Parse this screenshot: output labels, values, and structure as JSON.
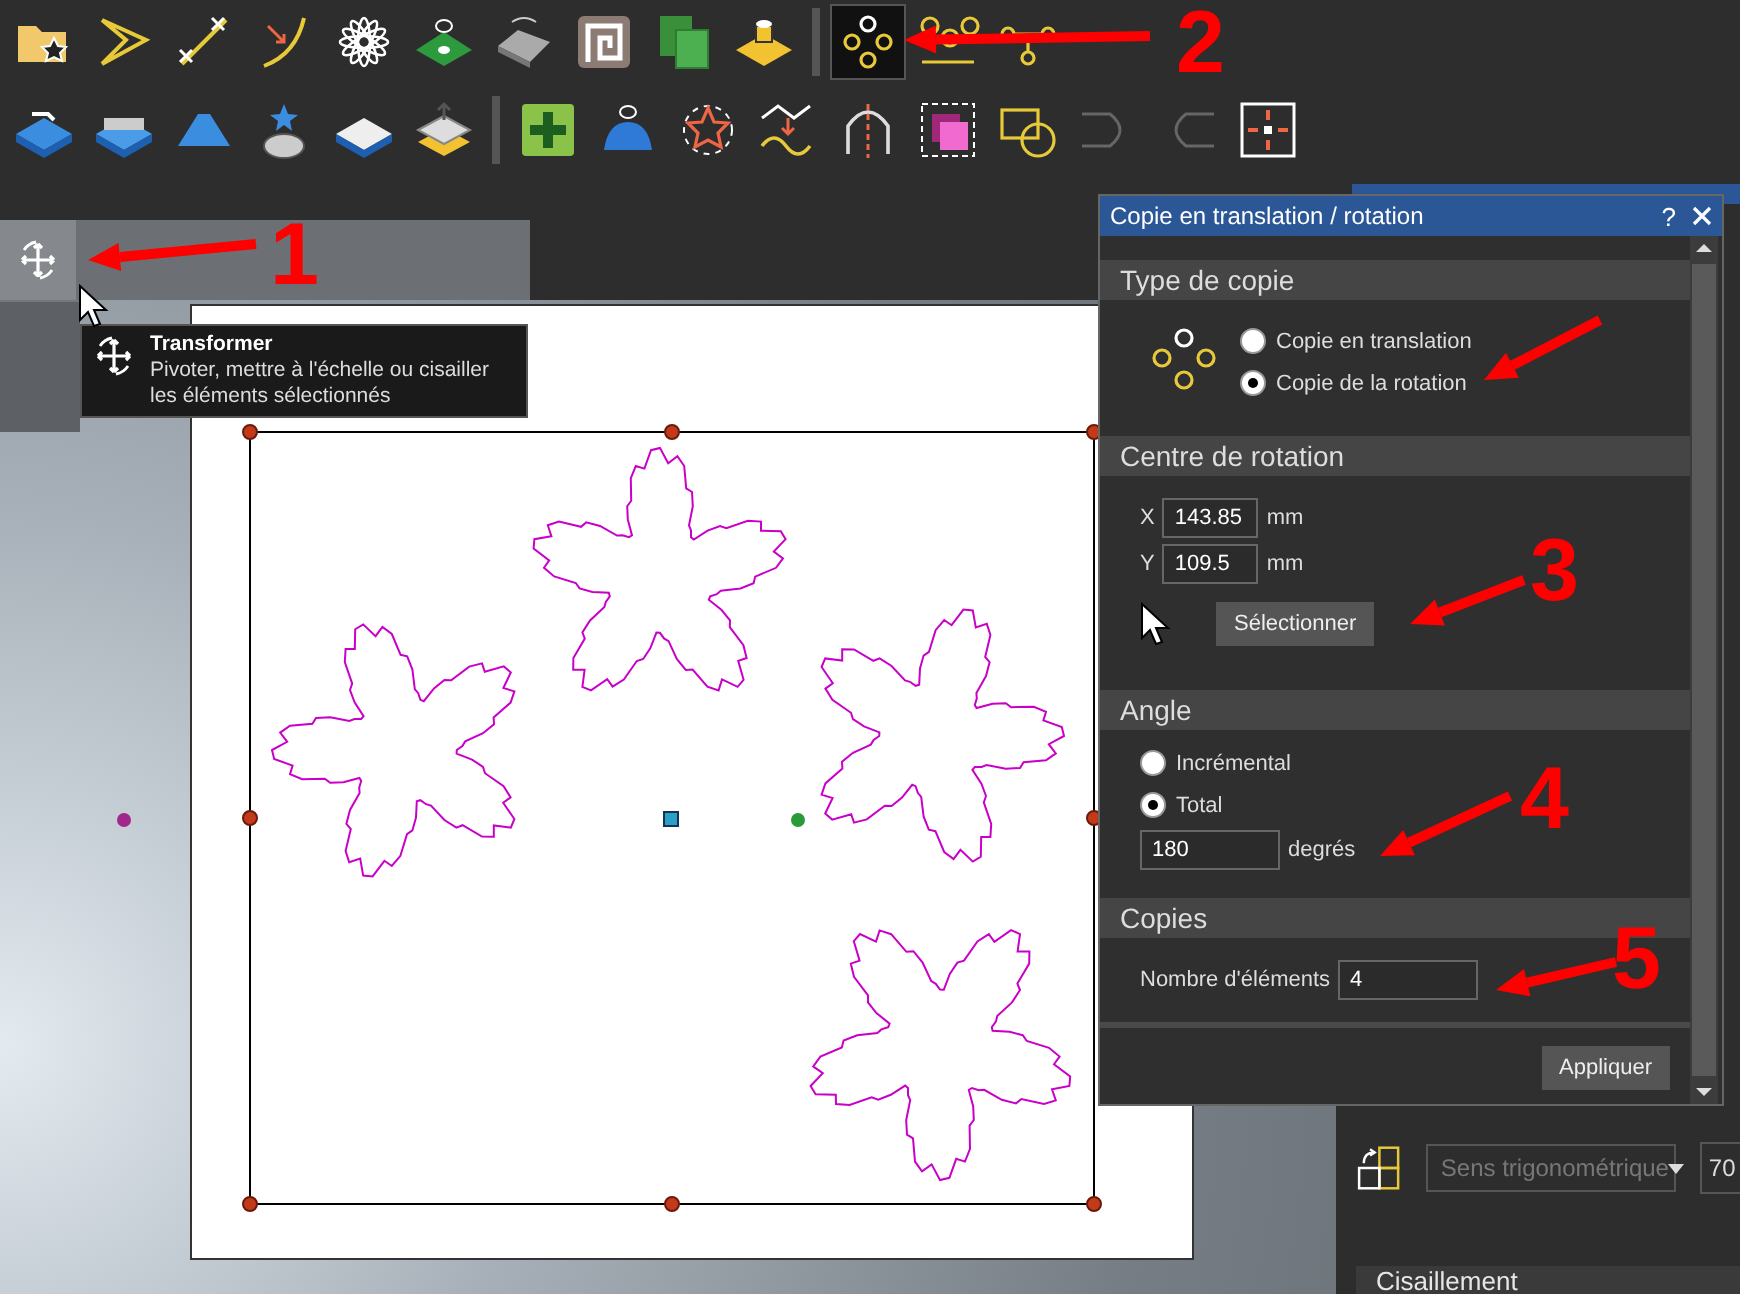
{
  "toolbar": {
    "rows": [
      {
        "items": [
          {
            "selected": false
          },
          {
            "selected": false
          },
          {
            "selected": false
          },
          {
            "selected": false
          },
          {
            "selected": false
          },
          {
            "selected": false
          },
          {
            "selected": false
          },
          {
            "selected": false
          },
          {
            "selected": false
          },
          {
            "selected": false
          },
          {
            "selected": true
          },
          {
            "selected": false
          },
          {
            "selected": false
          }
        ]
      },
      {
        "items": [
          {
            "selected": false
          },
          {
            "selected": false
          },
          {
            "selected": false
          },
          {
            "selected": false
          },
          {
            "selected": false
          },
          {
            "selected": false
          },
          {
            "selected": false
          },
          {
            "selected": false
          },
          {
            "selected": false
          },
          {
            "selected": false
          },
          {
            "selected": false
          },
          {
            "selected": false
          },
          {
            "selected": false
          },
          {
            "selected": false
          },
          {
            "selected": false
          },
          {
            "selected": false
          }
        ]
      }
    ]
  },
  "tool_flyout": {
    "selected": true
  },
  "tooltip": {
    "title": "Transformer",
    "description": "Pivoter, mettre à l'échelle ou cisailler les éléments sélectionnés"
  },
  "dialog": {
    "title": "Copie en translation / rotation",
    "help": "?",
    "copy_type": {
      "heading": "Type de copie",
      "options": [
        {
          "label": "Copie en translation",
          "selected": false
        },
        {
          "label": "Copie de la rotation",
          "selected": true
        }
      ]
    },
    "rotation_center": {
      "heading": "Centre de rotation",
      "fields": [
        {
          "axis": "X",
          "value": "143.85",
          "unit": "mm"
        },
        {
          "axis": "Y",
          "value": "109.5",
          "unit": "mm"
        }
      ],
      "select_button": "Sélectionner"
    },
    "angle": {
      "heading": "Angle",
      "options": [
        {
          "label": "Incrémental",
          "selected": false
        },
        {
          "label": "Total",
          "selected": true
        }
      ],
      "value": "180",
      "unit": "degrés"
    },
    "copies": {
      "heading": "Copies",
      "label": "Nombre d'éléments",
      "value": "4"
    },
    "apply_button": "Appliquer"
  },
  "side_panel": {
    "direction": "Sens trigonométrique",
    "value": "70",
    "section": "Cisaillement"
  },
  "annotations": [
    {
      "label": "1"
    },
    {
      "label": "2"
    },
    {
      "label": "3"
    },
    {
      "label": "4"
    },
    {
      "label": "5"
    }
  ]
}
